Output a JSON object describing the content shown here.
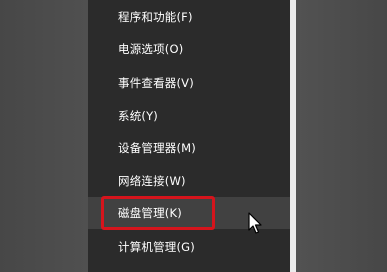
{
  "menu": {
    "items": [
      {
        "label": "程序和功能(F)"
      },
      {
        "label": "电源选项(O)"
      },
      {
        "label": "事件查看器(V)"
      },
      {
        "label": "系统(Y)"
      },
      {
        "label": "设备管理器(M)"
      },
      {
        "label": "网络连接(W)"
      },
      {
        "label": "磁盘管理(K)"
      },
      {
        "label": "计算机管理(G)"
      }
    ],
    "highlighted_index": 6,
    "highlight_color": "#d5141c"
  },
  "cursor": {
    "icon": "mouse-pointer-icon"
  }
}
